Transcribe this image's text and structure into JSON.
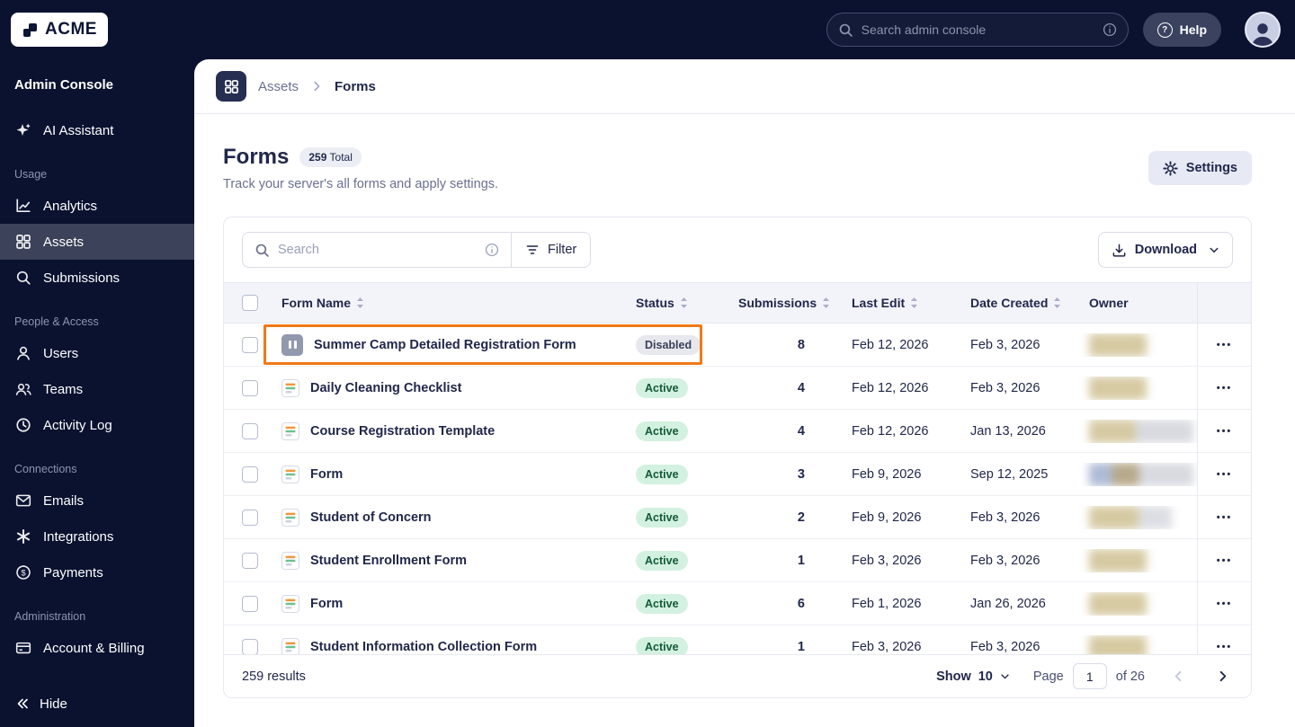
{
  "colors": {
    "sidebar_bg": "#0A1230",
    "selected_nav_bg": "#3B4259",
    "annotation_orange": "#EF7918",
    "active_badge_bg": "#D3F1E0",
    "active_badge_text": "#135A39",
    "disabled_badge_bg": "#E7E8EE",
    "disabled_badge_text": "#3A4058",
    "header_row_bg": "#F3F4F9"
  },
  "icons": {
    "logo": "blocks-icon",
    "topbar_search": "magnifier-icon",
    "topbar_info": "info-circle-icon",
    "help": "question-circle-icon",
    "avatar": "person-icon",
    "ai_assistant": "sparkles-icon",
    "analytics": "line-chart-icon",
    "assets": "grid-icon",
    "submissions": "magnifier-icon",
    "users": "person-icon",
    "teams": "people-icon",
    "activity_log": "clock-icon",
    "emails": "envelope-icon",
    "integrations": "asterisk-icon",
    "payments": "dollar-circle-icon",
    "account_billing": "credit-card-icon",
    "hide": "double-chevron-left-icon",
    "breadcrumb_app": "grid-icon",
    "settings": "gear-icon",
    "filter": "filter-lines-icon",
    "download": "download-icon",
    "sort": "sort-arrows-icon",
    "row_actions": "ellipsis-icon",
    "form": "form-document-icon",
    "paused_form": "pause-icon"
  },
  "topbar": {
    "logo_text": "ACME",
    "search_placeholder": "Search admin console",
    "help_label": "Help"
  },
  "sidebar": {
    "title": "Admin Console",
    "ai_item": "AI Assistant",
    "sections": [
      {
        "label": "Usage",
        "items": [
          {
            "label": "Analytics"
          },
          {
            "label": "Assets",
            "active": true
          },
          {
            "label": "Submissions"
          }
        ]
      },
      {
        "label": "People & Access",
        "items": [
          {
            "label": "Users"
          },
          {
            "label": "Teams"
          },
          {
            "label": "Activity Log"
          }
        ]
      },
      {
        "label": "Connections",
        "items": [
          {
            "label": "Emails"
          },
          {
            "label": "Integrations"
          },
          {
            "label": "Payments"
          }
        ]
      },
      {
        "label": "Administration",
        "items": [
          {
            "label": "Account & Billing"
          }
        ]
      }
    ],
    "hide_label": "Hide"
  },
  "breadcrumb": {
    "parent": "Assets",
    "current": "Forms"
  },
  "page": {
    "title": "Forms",
    "total_count": "259",
    "total_label": "Total",
    "subtitle": "Track your server's all forms and apply settings.",
    "settings_label": "Settings"
  },
  "toolbar": {
    "search_placeholder": "Search",
    "filter_label": "Filter",
    "download_label": "Download"
  },
  "table": {
    "columns": [
      "Form Name",
      "Status",
      "Submissions",
      "Last Edit",
      "Date Created",
      "Owner"
    ],
    "rows": [
      {
        "name": "Summer Camp Detailed Registration Form",
        "status": "Disabled",
        "submissions": "8",
        "last_edit": "Feb 12, 2026",
        "date_created": "Feb 3, 2026",
        "disabled": true,
        "highlighted": true
      },
      {
        "name": "Daily Cleaning Checklist",
        "status": "Active",
        "submissions": "4",
        "last_edit": "Feb 12, 2026",
        "date_created": "Feb 3, 2026"
      },
      {
        "name": "Course Registration Template",
        "status": "Active",
        "submissions": "4",
        "last_edit": "Feb 12, 2026",
        "date_created": "Jan 13, 2026"
      },
      {
        "name": "Form",
        "status": "Active",
        "submissions": "3",
        "last_edit": "Feb 9, 2026",
        "date_created": "Sep 12, 2025"
      },
      {
        "name": "Student of Concern",
        "status": "Active",
        "submissions": "2",
        "last_edit": "Feb 9, 2026",
        "date_created": "Feb 3, 2026"
      },
      {
        "name": "Student Enrollment Form",
        "status": "Active",
        "submissions": "1",
        "last_edit": "Feb 3, 2026",
        "date_created": "Feb 3, 2026"
      },
      {
        "name": "Form",
        "status": "Active",
        "submissions": "6",
        "last_edit": "Feb 1, 2026",
        "date_created": "Jan 26, 2026"
      },
      {
        "name": "Student Information Collection Form",
        "status": "Active",
        "submissions": "1",
        "last_edit": "Feb 3, 2026",
        "date_created": "Feb 3, 2026"
      }
    ]
  },
  "footer": {
    "results_text": "259 results",
    "show_label": "Show",
    "show_value": "10",
    "page_label": "Page",
    "page_value": "1",
    "of_text": "of 26"
  }
}
